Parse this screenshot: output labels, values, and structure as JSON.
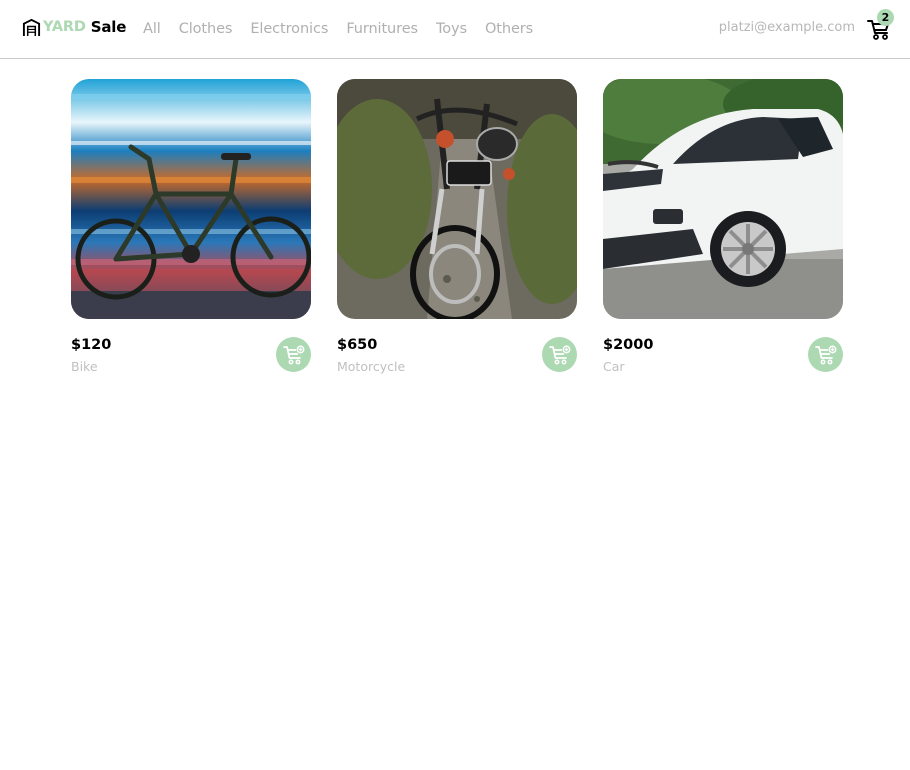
{
  "brand": {
    "part1": "YARD",
    "part2": "Sale"
  },
  "nav": {
    "items": [
      "All",
      "Clothes",
      "Electronics",
      "Furnitures",
      "Toys",
      "Others"
    ],
    "email": "platzi@example.com",
    "cart_count": "2"
  },
  "colors": {
    "accent": "#acd9b2",
    "muted_text": "#b0b0b0",
    "divider": "#c8c8c8"
  },
  "products": [
    {
      "price": "$120",
      "name": "Bike",
      "image": "bicycle-photo"
    },
    {
      "price": "$650",
      "name": "Motorcycle",
      "image": "motorcycle-photo"
    },
    {
      "price": "$2000",
      "name": "Car",
      "image": "suv-car-photo"
    }
  ]
}
